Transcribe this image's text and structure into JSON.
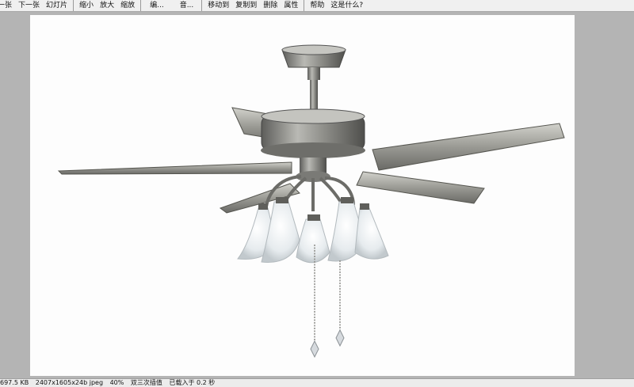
{
  "toolbar": {
    "prev": "上一张",
    "next": "下一张",
    "slideshow": "幻灯片",
    "zoom_out": "缩小",
    "zoom_in": "放大",
    "scale": "缩放",
    "edit": "编...",
    "audio": "音...",
    "move_to": "移动到",
    "copy_to": "复制到",
    "delete": "删除",
    "properties": "属性",
    "help": "帮助",
    "whats_this": "这是什么?"
  },
  "image": {
    "subject": "ceiling-fan-with-lights",
    "background": "#fdfdfd"
  },
  "status": {
    "file_size": "697.5 KB",
    "dimensions": "2407x1605x24b jpeg",
    "zoom": "40%",
    "interpolation": "双三次插值",
    "load_time": "已载入于 0.2 秒"
  },
  "colors": {
    "toolbar_bg": "#f0f0f0",
    "viewer_bg": "#b4b4b4",
    "metal": "#8a8a86"
  }
}
